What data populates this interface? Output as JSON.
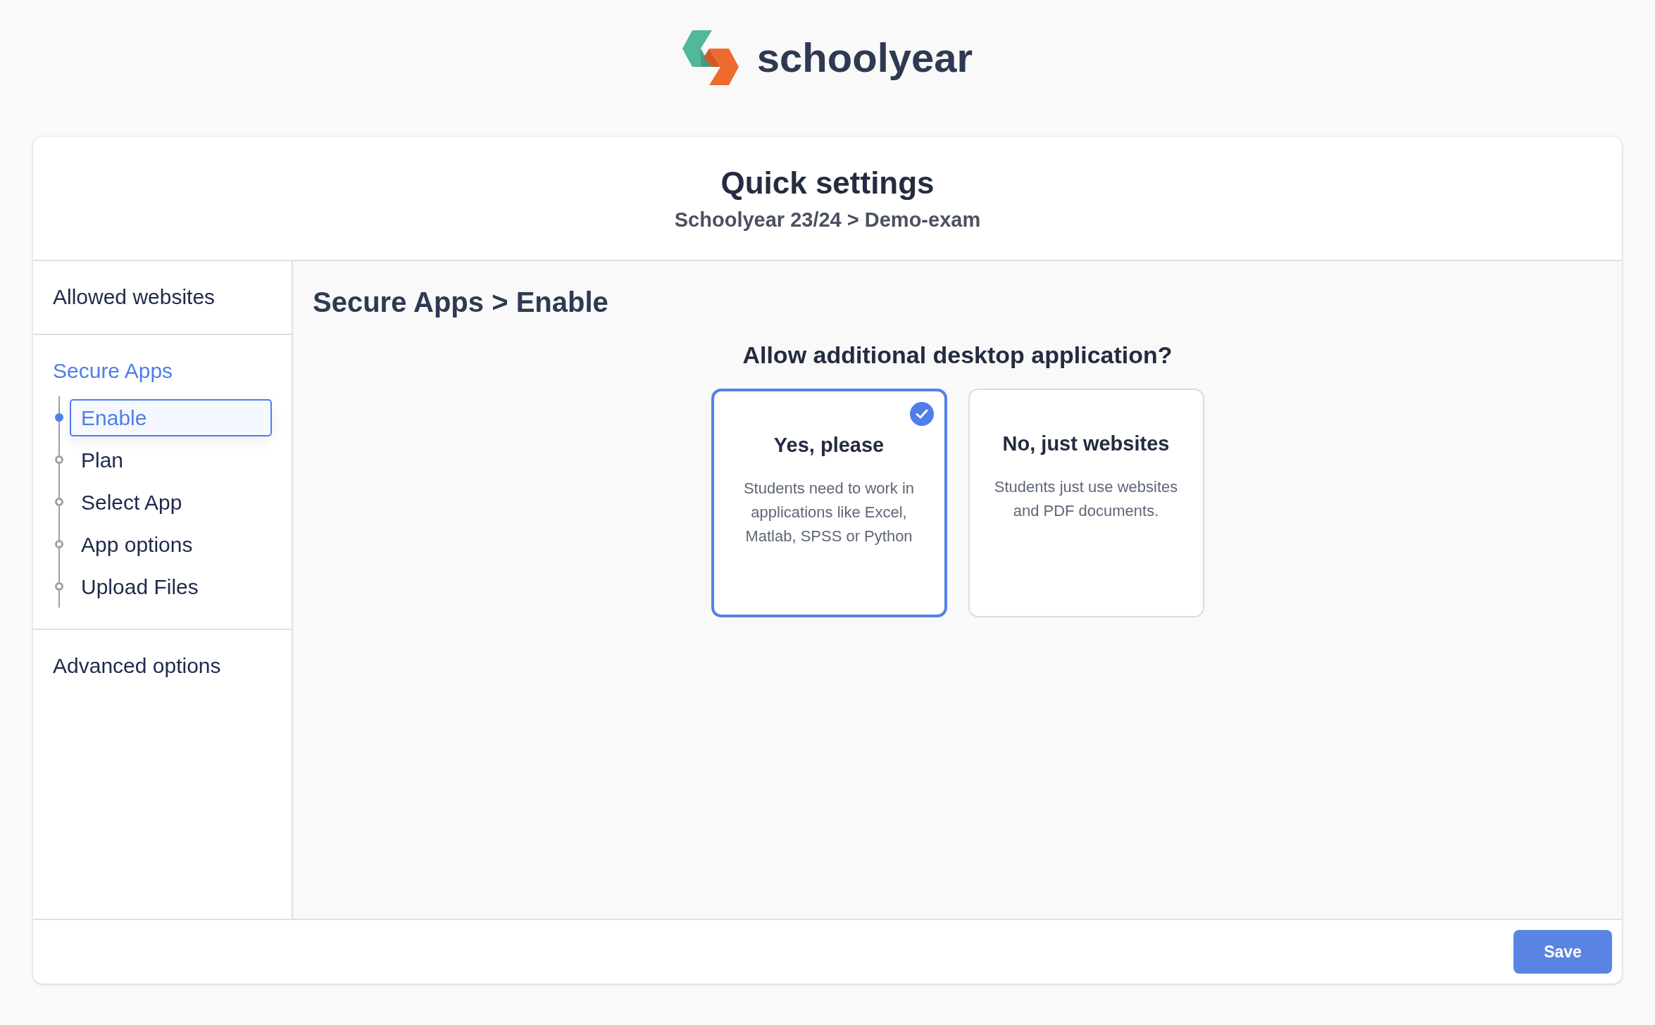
{
  "logo": {
    "text": "schoolyear"
  },
  "header": {
    "title": "Quick settings",
    "breadcrumb": "Schoolyear 23/24 > Demo-exam"
  },
  "sidebar": {
    "sections": [
      {
        "label": "Allowed websites",
        "selected": false
      },
      {
        "label": "Secure Apps",
        "selected": true,
        "children": [
          {
            "label": "Enable",
            "selected": true
          },
          {
            "label": "Plan",
            "selected": false
          },
          {
            "label": "Select App",
            "selected": false
          },
          {
            "label": "App options",
            "selected": false
          },
          {
            "label": "Upload Files",
            "selected": false
          }
        ]
      },
      {
        "label": "Advanced options",
        "selected": false
      }
    ]
  },
  "main": {
    "title": "Secure Apps > Enable",
    "question": "Allow additional desktop application?",
    "options": [
      {
        "title": "Yes, please",
        "description": "Students need to work in applications like Excel, Matlab, SPSS or Python",
        "selected": true
      },
      {
        "title": "No, just websites",
        "description": "Students just use websites and PDF documents.",
        "selected": false
      }
    ]
  },
  "footer": {
    "save_button": "Save"
  }
}
